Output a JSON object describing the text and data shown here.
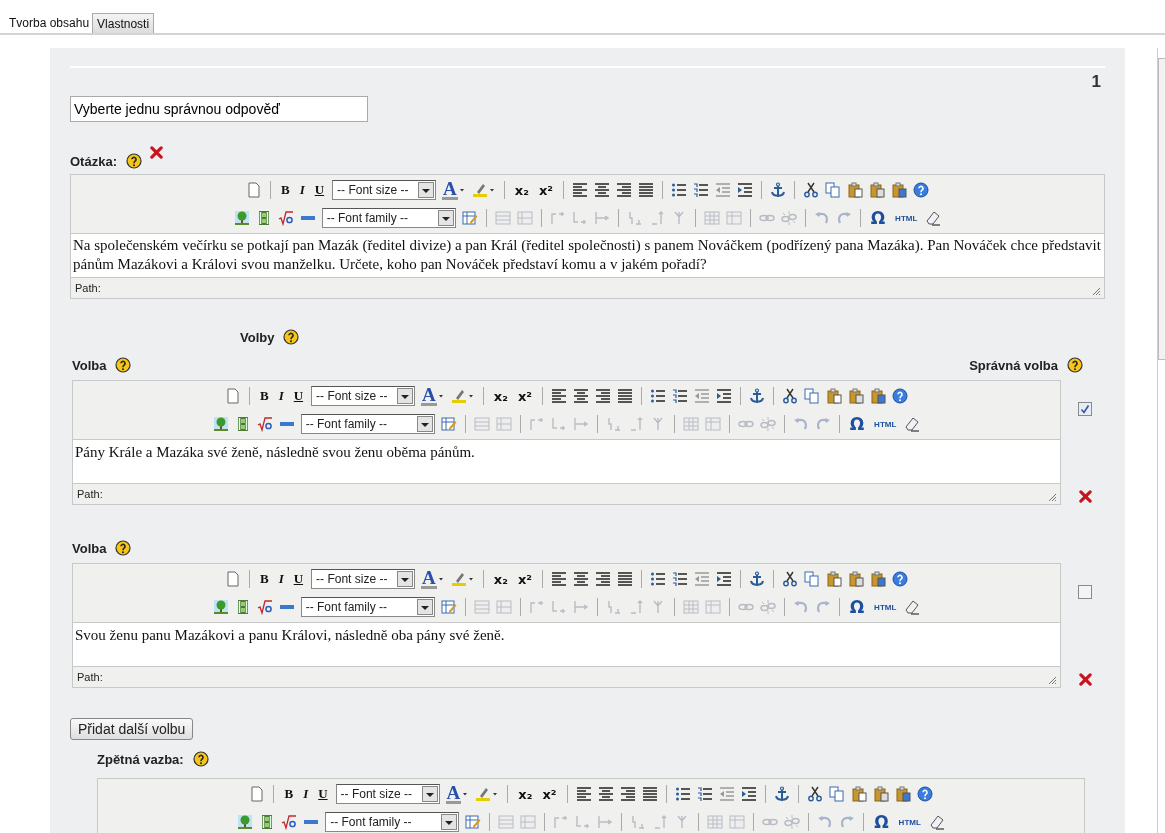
{
  "tabs": [
    {
      "label": "Tvorba obsahu",
      "selected": true
    },
    {
      "label": "Vlastnosti",
      "selected": false
    }
  ],
  "question_number": "1",
  "title_field": {
    "value": "Vyberte jednu správnou odpověď"
  },
  "question": {
    "label": "Otázka:",
    "editor": {
      "toolbar": {
        "bold": "B",
        "italic": "I",
        "underline": "U",
        "font_size": "-- Font size --",
        "font_color": "A",
        "subscript": "x₂",
        "superscript": "x²",
        "font_family": "-- Font family --",
        "special_char": "Ω",
        "html": "HTML"
      },
      "content": "Na společenském večírku se potkají pan Mazák (ředitel divize) a pan Král (ředitel společnosti) s panem Nováčkem (podřízený pana Mazáka). Pan Nováček chce představit pánům Mazákovi a Královi svou manželku. Určete, koho pan Nováček představí komu a v jakém pořadí?",
      "path_label": "Path:"
    }
  },
  "choices_heading": "Volby",
  "correct_column_label": "Správná volba",
  "choices": [
    {
      "label": "Volba",
      "checked": true,
      "editor": {
        "toolbar": {
          "bold": "B",
          "italic": "I",
          "underline": "U",
          "font_size": "-- Font size --",
          "font_color": "A",
          "subscript": "x₂",
          "superscript": "x²",
          "font_family": "-- Font family --",
          "special_char": "Ω",
          "html": "HTML"
        },
        "content": "Pány Krále a Mazáka své ženě, následně svou ženu oběma pánům.",
        "path_label": "Path:"
      }
    },
    {
      "label": "Volba",
      "checked": false,
      "editor": {
        "toolbar": {
          "bold": "B",
          "italic": "I",
          "underline": "U",
          "font_size": "-- Font size --",
          "font_color": "A",
          "subscript": "x₂",
          "superscript": "x²",
          "font_family": "-- Font family --",
          "special_char": "Ω",
          "html": "HTML"
        },
        "content": "Svou ženu panu Mazákovi a panu Královi, následně oba pány své ženě.",
        "path_label": "Path:"
      }
    }
  ],
  "add_choice_button": "Přidat další volbu",
  "feedback": {
    "label": "Zpětná vazba:",
    "editor": {
      "toolbar": {
        "bold": "B",
        "italic": "I",
        "underline": "U",
        "font_size": "-- Font size --",
        "font_color": "A",
        "subscript": "x₂",
        "superscript": "x²",
        "font_family": "-- Font family --",
        "special_char": "Ω",
        "html": "HTML"
      }
    }
  }
}
